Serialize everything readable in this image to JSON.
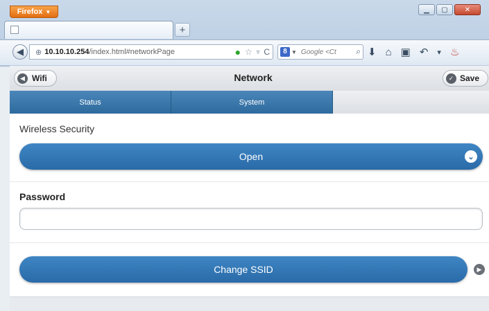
{
  "browser": {
    "app_button": "Firefox",
    "tab_title": "",
    "new_tab": "+",
    "url_host": "10.10.10.254",
    "url_path": "/index.html#networkPage",
    "search_engine_letter": "8",
    "search_placeholder": "Google <Ct",
    "window_controls": [
      "minimize-icon",
      "maximize-icon",
      "close-icon"
    ]
  },
  "header": {
    "back_label": "Wifi",
    "title": "Network",
    "save_label": "Save"
  },
  "tabs": [
    {
      "label": "Status"
    },
    {
      "label": "System"
    }
  ],
  "form": {
    "security_label": "Wireless Security",
    "security_value": "Open",
    "password_label": "Password",
    "password_value": "",
    "change_ssid_label": "Change SSID"
  },
  "colors": {
    "accent": "#2f6fa9",
    "tab_bg": "#3b78ad",
    "header_bg": "#e3e6ea"
  }
}
